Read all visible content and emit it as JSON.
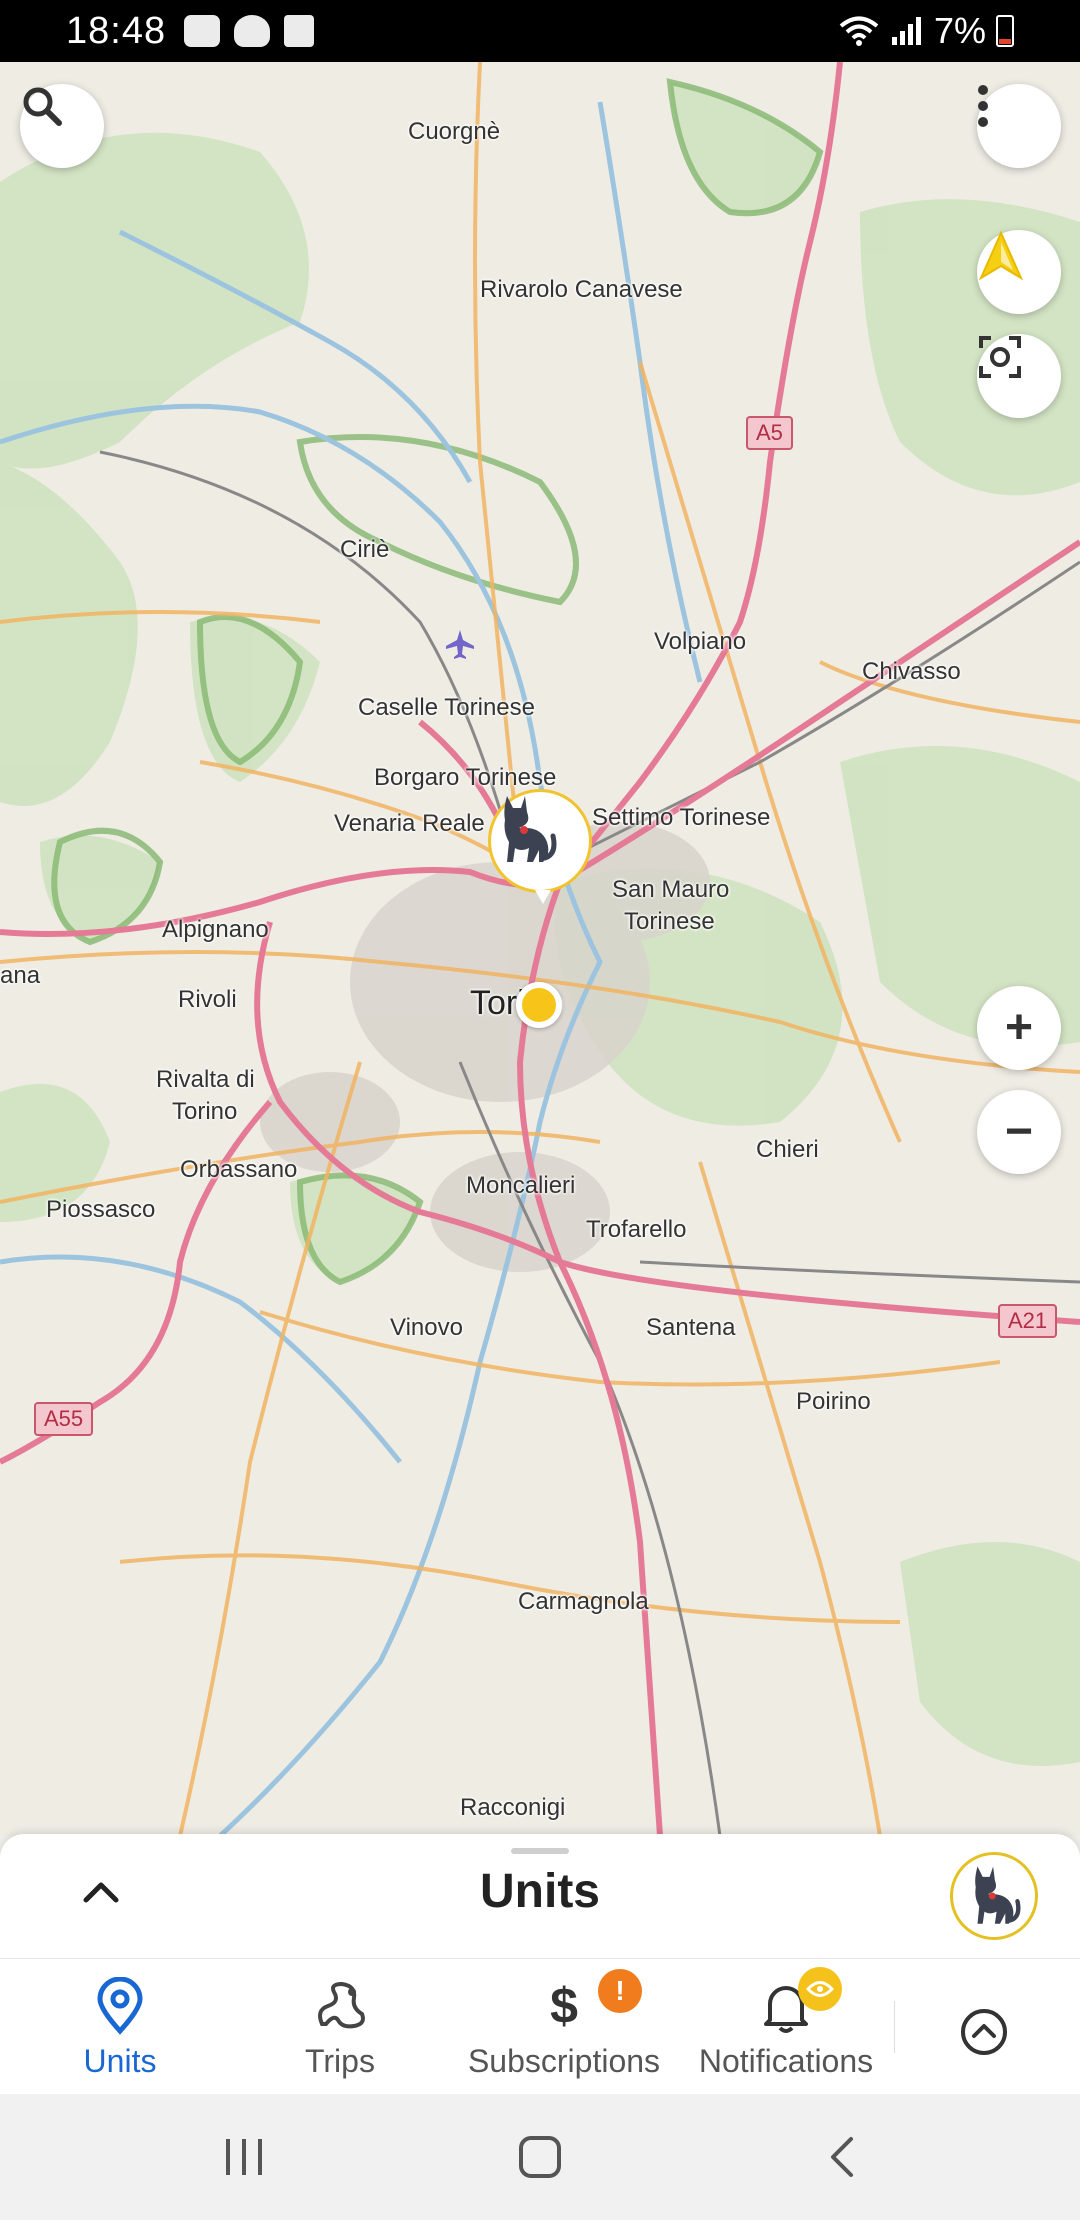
{
  "status_bar": {
    "time": "18:48",
    "battery": "7%"
  },
  "map": {
    "places": [
      {
        "name": "Cuorgnè",
        "type": "town"
      },
      {
        "name": "Rivarolo Canavese",
        "type": "town"
      },
      {
        "name": "Ciriè",
        "type": "town"
      },
      {
        "name": "Volpiano",
        "type": "town"
      },
      {
        "name": "Chivasso",
        "type": "town"
      },
      {
        "name": "Caselle Torinese",
        "type": "town"
      },
      {
        "name": "Borgaro Torinese",
        "type": "town"
      },
      {
        "name": "Venaria Reale",
        "type": "town"
      },
      {
        "name": "Settimo Torinese",
        "type": "town"
      },
      {
        "name": "San Mauro",
        "type": "town"
      },
      {
        "name": "Torinese",
        "type": "town"
      },
      {
        "name": "Alpignano",
        "type": "town"
      },
      {
        "name": "ana",
        "type": "town"
      },
      {
        "name": "Rivoli",
        "type": "town"
      },
      {
        "name": "Torino",
        "type": "city"
      },
      {
        "name": "Rivalta di",
        "type": "town"
      },
      {
        "name": "Torino",
        "type": "town"
      },
      {
        "name": "Orbassano",
        "type": "town"
      },
      {
        "name": "Chieri",
        "type": "town"
      },
      {
        "name": "Piossasco",
        "type": "town"
      },
      {
        "name": "Moncalieri",
        "type": "town"
      },
      {
        "name": "Trofarello",
        "type": "town"
      },
      {
        "name": "Vinovo",
        "type": "town"
      },
      {
        "name": "Santena",
        "type": "town"
      },
      {
        "name": "Poirino",
        "type": "town"
      },
      {
        "name": "Carmagnola",
        "type": "town"
      },
      {
        "name": "Racconigi",
        "type": "town"
      }
    ],
    "highway_shields": [
      "A5",
      "A21",
      "A55"
    ],
    "controls": {
      "search": "search-icon",
      "menu": "more-vert-icon",
      "navigate": "navigation-arrow-icon",
      "center": "center-focus-icon",
      "zoom_in": "+",
      "zoom_out": "−"
    },
    "colors": {
      "pet_marker_border": "#f1c32e",
      "position_dot": "#f7c51a"
    }
  },
  "sheet": {
    "title": "Units"
  },
  "nav": {
    "items": [
      {
        "label": "Units",
        "icon": "location-pin-icon",
        "active": true
      },
      {
        "label": "Trips",
        "icon": "route-icon",
        "active": false
      },
      {
        "label": "Subscriptions",
        "icon": "dollar-icon",
        "active": false,
        "badge": "!"
      },
      {
        "label": "Notifications",
        "icon": "bell-icon",
        "active": false
      }
    ],
    "active_color": "#1967d2",
    "badge_colors": {
      "subscriptions": "#f07c1e",
      "notifications": "#f5c21b"
    }
  }
}
